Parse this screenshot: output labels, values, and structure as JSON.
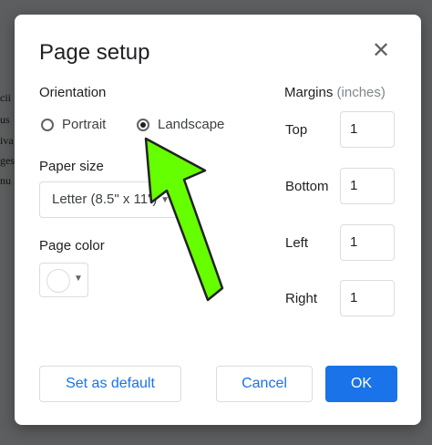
{
  "background_doc": {
    "fragments": [
      "cii",
      "us",
      "iva",
      "ges",
      "nu"
    ]
  },
  "dialog": {
    "title": "Page setup",
    "close_icon": "close-icon"
  },
  "orientation": {
    "label": "Orientation",
    "options": [
      "Portrait",
      "Landscape"
    ],
    "selected": "Landscape"
  },
  "paper_size": {
    "label": "Paper size",
    "value": "Letter (8.5\" x 11\")"
  },
  "page_color": {
    "label": "Page color",
    "value": "#ffffff"
  },
  "margins": {
    "label": "Margins",
    "unit_label": "(inches)",
    "fields": [
      {
        "label": "Top",
        "value": "1"
      },
      {
        "label": "Bottom",
        "value": "1"
      },
      {
        "label": "Left",
        "value": "1"
      },
      {
        "label": "Right",
        "value": "1"
      }
    ]
  },
  "buttons": {
    "set_default": "Set as default",
    "cancel": "Cancel",
    "ok": "OK"
  },
  "colors": {
    "accent": "#1a73e8",
    "annotation_arrow_fill": "#66ff00",
    "annotation_arrow_stroke": "#222222"
  }
}
